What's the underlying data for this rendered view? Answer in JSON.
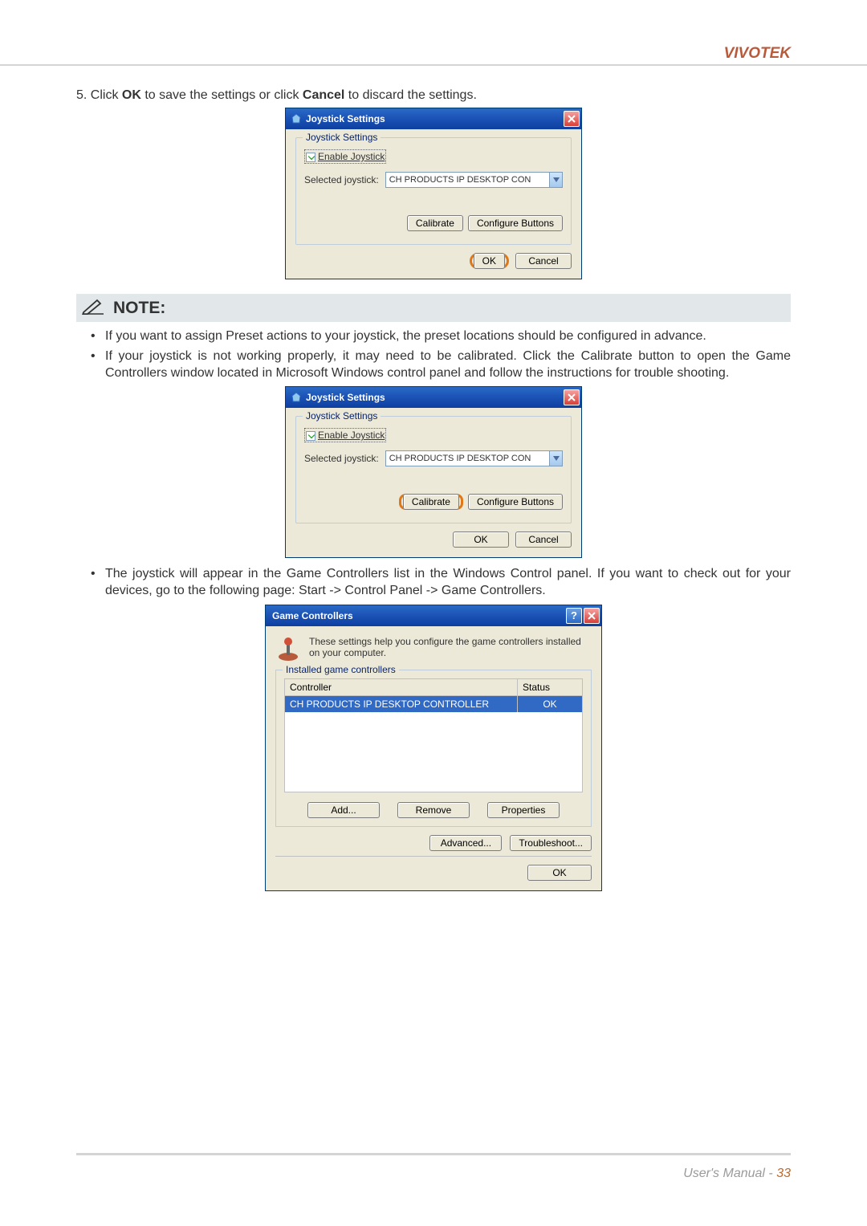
{
  "header": {
    "brand": "VIVOTEK"
  },
  "step": {
    "prefix": "5. Click ",
    "bold1": "OK",
    "mid": " to save the settings or click ",
    "bold2": "Cancel",
    "suffix": " to discard the settings."
  },
  "joystick_dialog": {
    "title": "Joystick Settings",
    "legend": "Joystick Settings",
    "enable_label": "Enable Joystick",
    "selected_label": "Selected joystick:",
    "selected_value": "CH PRODUCTS IP DESKTOP CON",
    "calibrate": "Calibrate",
    "configure": "Configure Buttons",
    "ok": "OK",
    "cancel": "Cancel"
  },
  "note": {
    "title": "NOTE:",
    "items": [
      "If you want to assign Preset actions to your joystick, the preset locations should be configured in advance.",
      "If your joystick is not working properly, it may need to be calibrated. Click the Calibrate button to open the Game Controllers window located in Microsoft Windows control panel and follow the instructions for trouble shooting.",
      "The joystick will appear in the Game Controllers list in the Windows Control panel. If you want to check out for your devices, go to the following page: Start -> Control Panel -> Game Controllers."
    ]
  },
  "game_controllers": {
    "title": "Game Controllers",
    "desc": "These settings help you configure the game controllers installed on your computer.",
    "legend": "Installed game controllers",
    "col1": "Controller",
    "col2": "Status",
    "row_name": "CH PRODUCTS IP DESKTOP CONTROLLER",
    "row_status": "OK",
    "add": "Add...",
    "remove": "Remove",
    "properties": "Properties",
    "advanced": "Advanced...",
    "troubleshoot": "Troubleshoot...",
    "ok": "OK"
  },
  "footer": {
    "manual": "User's Manual - ",
    "page": "33"
  }
}
